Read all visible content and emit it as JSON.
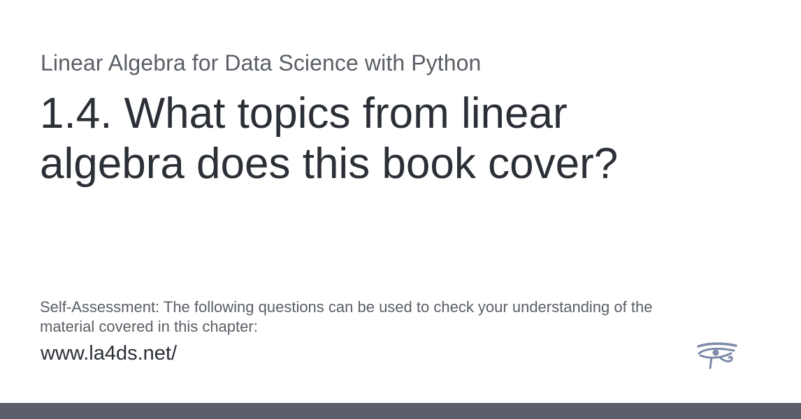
{
  "site": {
    "title": "Linear Algebra for Data Science with Python",
    "url": "www.la4ds.net/",
    "logo_icon": "eye-of-horus-icon",
    "logo_color": "#7d8aa8"
  },
  "page": {
    "title": "1.4. What topics from linear algebra does this book cover?",
    "description": "Self-Assessment: The following questions can be used to check your understanding of the material covered in this chapter:"
  },
  "colors": {
    "background": "#ffffff",
    "title_text": "#2b2f36",
    "muted_text": "#5a5f66",
    "footer_bar": "#5a5f6a"
  }
}
